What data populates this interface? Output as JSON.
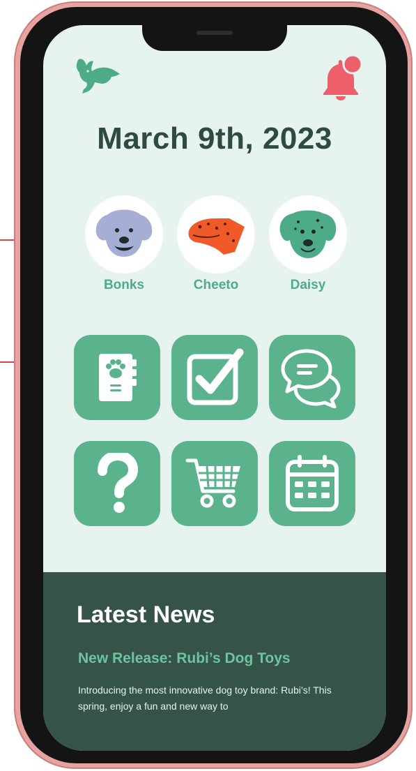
{
  "date": "March 9th, 2023",
  "colors": {
    "background": "#e7f3ee",
    "accent": "#5bb38e",
    "heading": "#2e4b42",
    "news_bg": "#355349",
    "alert": "#ee5f6c",
    "frame": "#e7a3a0"
  },
  "header": {
    "logo_icon": "rabbit-icon",
    "notification_icon": "bell-icon"
  },
  "pets": [
    {
      "name": "Bonks",
      "icon": "golden-retriever-icon"
    },
    {
      "name": "Cheeto",
      "icon": "gecko-icon"
    },
    {
      "name": "Daisy",
      "icon": "dalmatian-icon"
    }
  ],
  "actions": [
    {
      "icon": "paw-notebook-icon"
    },
    {
      "icon": "checkbox-icon"
    },
    {
      "icon": "chat-icon"
    },
    {
      "icon": "help-icon"
    },
    {
      "icon": "shopping-cart-icon"
    },
    {
      "icon": "calendar-icon"
    }
  ],
  "news": {
    "title": "Latest News",
    "headline": "New Release: Rubi’s Dog Toys",
    "body": "Introducing the most innovative dog toy brand: Rubi’s! This spring, enjoy a fun and new way to"
  }
}
